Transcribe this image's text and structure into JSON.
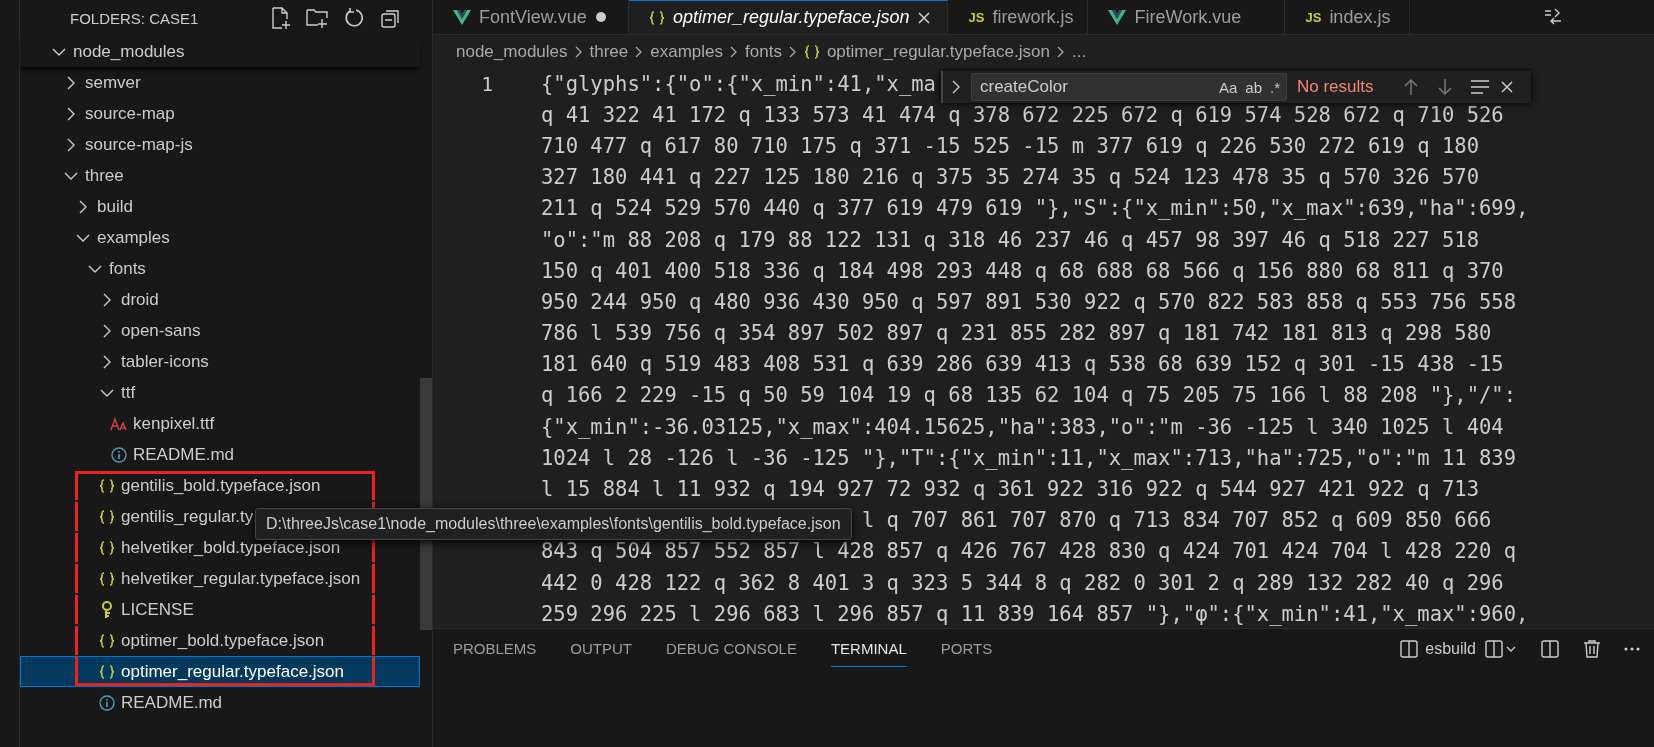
{
  "explorer": {
    "title": "FOLDERS: CASE1",
    "tree": [
      {
        "label": "node_modules",
        "kind": "folder",
        "expanded": true,
        "selected": false,
        "children": [
          {
            "label": "semver",
            "kind": "folder",
            "expanded": false,
            "selected": false
          },
          {
            "label": "source-map",
            "kind": "folder",
            "expanded": false,
            "selected": false
          },
          {
            "label": "source-map-js",
            "kind": "folder",
            "expanded": false,
            "selected": false
          },
          {
            "label": "three",
            "kind": "folder",
            "expanded": true,
            "selected": false,
            "children": [
              {
                "label": "build",
                "kind": "folder",
                "expanded": false,
                "selected": false
              },
              {
                "label": "examples",
                "kind": "folder",
                "expanded": true,
                "selected": false,
                "children": [
                  {
                    "label": "fonts",
                    "kind": "folder",
                    "expanded": true,
                    "selected": false,
                    "children": [
                      {
                        "label": "droid",
                        "kind": "folder",
                        "expanded": false,
                        "selected": false,
                        "marked": false
                      },
                      {
                        "label": "open-sans",
                        "kind": "folder",
                        "expanded": false,
                        "selected": false,
                        "marked": false
                      },
                      {
                        "label": "tabler-icons",
                        "kind": "folder",
                        "expanded": false,
                        "selected": false,
                        "marked": false
                      },
                      {
                        "label": "ttf",
                        "kind": "folder",
                        "expanded": true,
                        "selected": false,
                        "marked": false,
                        "children": [
                          {
                            "label": "kenpixel.ttf",
                            "kind": "font",
                            "selected": false
                          },
                          {
                            "label": "README.md",
                            "kind": "info",
                            "selected": false
                          }
                        ]
                      },
                      {
                        "label": "gentilis_bold.typeface.json",
                        "kind": "json",
                        "selected": false,
                        "marked": true
                      },
                      {
                        "label": "gentilis_regular.ty",
                        "kind": "json",
                        "selected": false,
                        "marked": true
                      },
                      {
                        "label": "helvetiker_bold.typeface.json",
                        "kind": "json",
                        "selected": false,
                        "marked": true
                      },
                      {
                        "label": "helvetiker_regular.typeface.json",
                        "kind": "json",
                        "selected": false,
                        "marked": true
                      },
                      {
                        "label": "LICENSE",
                        "kind": "license",
                        "selected": false,
                        "marked": true
                      },
                      {
                        "label": "optimer_bold.typeface.json",
                        "kind": "json",
                        "selected": false,
                        "marked": true
                      },
                      {
                        "label": "optimer_regular.typeface.json",
                        "kind": "json",
                        "selected": true,
                        "marked": true
                      },
                      {
                        "label": "README.md",
                        "kind": "info",
                        "selected": false,
                        "marked": false
                      }
                    ]
                  }
                ]
              }
            ]
          }
        ]
      }
    ]
  },
  "tabs": [
    {
      "label": "FontView.vue",
      "kind": "vue",
      "selected": false,
      "preview": false,
      "dirty": true
    },
    {
      "label": "optimer_regular.typeface.json",
      "kind": "json",
      "selected": true,
      "preview": true,
      "dirty": false
    },
    {
      "label": "firework.js",
      "kind": "js",
      "badge": "JS",
      "selected": false,
      "preview": false,
      "dirty": false
    },
    {
      "label": "FireWork.vue",
      "kind": "vue",
      "selected": false,
      "preview": false,
      "dirty": false
    },
    {
      "label": "index.js",
      "kind": "js",
      "badge": "JS",
      "selected": false,
      "preview": false,
      "dirty": false
    }
  ],
  "breadcrumb": [
    {
      "label": "node_modules",
      "kind": "folder"
    },
    {
      "label": "three",
      "kind": "folder"
    },
    {
      "label": "examples",
      "kind": "folder"
    },
    {
      "label": "fonts",
      "kind": "folder"
    },
    {
      "label": "optimer_regular.typeface.json",
      "kind": "json"
    },
    {
      "label": "...",
      "kind": "more"
    }
  ],
  "editor": {
    "lines": [
      {
        "number": "1",
        "rows": [
          {
            "kind": "full",
            "text": "{\"glyphs\":{\"o\":{\"x_min\":41,\"x_ma"
          },
          {
            "kind": "full",
            "text": "q 41 322 41 172 q 133 573 41 474 q 378 672 225 672 q 619 574 528 672 q 710 526"
          },
          {
            "kind": "full",
            "text": "710 477 q 617 80 710 175 q 371 -15 525 -15 m 377 619 q 226 530 272 619 q 180"
          },
          {
            "kind": "full",
            "text": "327 180 441 q 227 125 180 216 q 375 35 274 35 q 524 123 478 35 q 570 326 570"
          },
          {
            "kind": "full",
            "text": "211 q 524 529 570 440 q 377 619 479 619 \"},\"S\":{\"x_min\":50,\"x_max\":639,\"ha\":699,"
          },
          {
            "kind": "full",
            "text": "\"o\":\"m 88 208 q 179 88 122 131 q 318 46 237 46 q 457 98 397 46 q 518 227 518"
          },
          {
            "kind": "full",
            "text": "150 q 401 400 518 336 q 184 498 293 448 q 68 688 68 566 q 156 880 68 811 q 370"
          },
          {
            "kind": "full",
            "text": "950 244 950 q 480 936 430 950 q 597 891 530 922 q 570 822 583 858 q 553 756 558"
          },
          {
            "kind": "full",
            "text": "786 l 539 756 q 354 897 502 897 q 231 855 282 897 q 181 742 181 813 q 298 580"
          },
          {
            "kind": "full",
            "text": "181 640 q 519 483 408 531 q 639 286 639 413 q 538 68 639 152 q 301 -15 438 -15"
          },
          {
            "kind": "full",
            "text": "q 166 2 229 -15 q 50 59 104 19 q 68 135 62 104 q 75 205 75 166 l 88 208 \"},\"/\":"
          },
          {
            "kind": "full",
            "text": "{\"x_min\":-36.03125,\"x_max\":404.15625,\"ha\":383,\"o\":\"m -36 -125 l 340 1025 l 404"
          },
          {
            "kind": "full",
            "text": "1024 l 28 -126 l -36 -125 \"},\"T\":{\"x_min\":11,\"x_max\":713,\"ha\":725,\"o\":\"m 11 839"
          },
          {
            "kind": "full",
            "text": "l 15 884 l 11 932 q 194 927 72 932 q 361 922 316 922 q 544 927 421 922 q 713"
          },
          {
            "kind": "tail",
            "text": "l q 707 861 707 870 q 713 834 707 852 q 609 850 666"
          },
          {
            "kind": "full",
            "text": "843 q 504 857 552 857 l 428 857 q 426 767 428 830 q 424 701 424 704 l 428 220 q"
          },
          {
            "kind": "full",
            "text": "442 0 428 122 q 362 8 401 3 q 323 5 344 8 q 282 0 301 2 q 289 132 282 40 q 296"
          },
          {
            "kind": "full",
            "text": "259 296 225 l 296 683 l 296 857 q 11 839 164 857 \"},\"φ\":{\"x_min\":41,\"x_max\":960,"
          }
        ]
      }
    ]
  },
  "find": {
    "value": "createColor",
    "options": [
      "Aa",
      "ab",
      ".*"
    ],
    "result": "No results"
  },
  "tooltip": "D:\\threeJs\\case1\\node_modules\\three\\examples\\fonts\\gentilis_bold.typeface.json",
  "panel": {
    "tabs": [
      {
        "label": "PROBLEMS",
        "selected": false
      },
      {
        "label": "OUTPUT",
        "selected": false
      },
      {
        "label": "DEBUG CONSOLE",
        "selected": false
      },
      {
        "label": "TERMINAL",
        "selected": true
      },
      {
        "label": "PORTS",
        "selected": false
      }
    ],
    "terminal": "esbuild"
  }
}
